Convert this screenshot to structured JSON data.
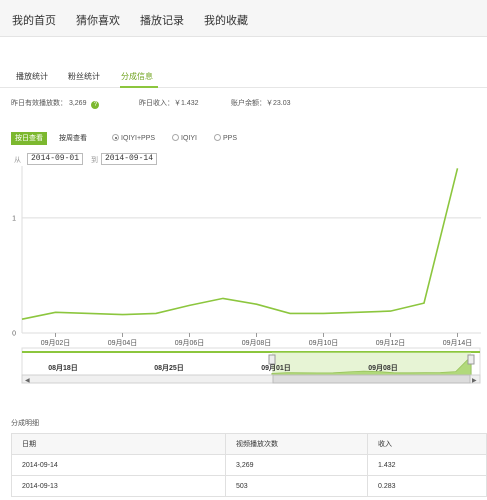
{
  "nav": {
    "items": [
      "我的首页",
      "猜你喜欢",
      "播放记录",
      "我的收藏"
    ]
  },
  "tabs": {
    "items": [
      "播放统计",
      "粉丝统计",
      "分成信息"
    ],
    "active_index": 2
  },
  "stats": {
    "plays_label": "昨日有效播放数：",
    "plays_value": "3,269",
    "income": "昨日收入：￥1.432",
    "balance": "账户余额：￥23.03"
  },
  "controls": {
    "by_day": "按日查看",
    "by_week": "按周查看",
    "radios": [
      "IQIYI+PPS",
      "IQIYI",
      "PPS"
    ],
    "radio_selected": 0,
    "from_label": "从",
    "from_date": "2014-09-01",
    "to_label": "到",
    "to_date": "2014-09-14"
  },
  "chart_data": {
    "type": "line",
    "y_ticks": [
      "0",
      "1"
    ],
    "ylim": [
      0,
      1.45
    ],
    "grid": true,
    "x_tick_labels": [
      "09月02日",
      "09月04日",
      "09月06日",
      "09月08日",
      "09月10日",
      "09月12日",
      "09月14日"
    ],
    "x_dates": [
      "09-01",
      "09-02",
      "09-03",
      "09-04",
      "09-05",
      "09-06",
      "09-07",
      "09-08",
      "09-09",
      "09-10",
      "09-11",
      "09-12",
      "09-13",
      "09-14"
    ],
    "series": [
      {
        "color": "#8cc63e",
        "values": [
          0.12,
          0.18,
          0.17,
          0.16,
          0.17,
          0.24,
          0.3,
          0.25,
          0.17,
          0.17,
          0.18,
          0.19,
          0.26,
          1.43
        ]
      }
    ],
    "navigator_labels": [
      "08月18日",
      "08月25日",
      "09月01日",
      "09月08日"
    ]
  },
  "table": {
    "title": "分成明细",
    "headers": [
      "日期",
      "视频播放次数",
      "收入"
    ],
    "rows": [
      [
        "2014-09-14",
        "3,269",
        "1.432"
      ],
      [
        "2014-09-13",
        "503",
        "0.283"
      ]
    ]
  },
  "colors": {
    "accent": "#8cc63e",
    "accent_dark": "#71a421"
  }
}
